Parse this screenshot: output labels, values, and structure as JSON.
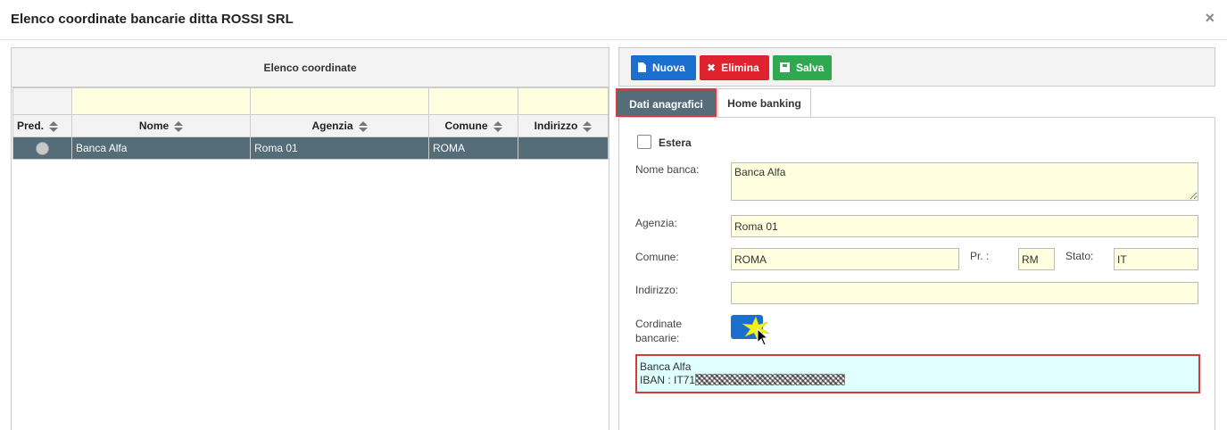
{
  "dialog": {
    "title": "Elenco coordinate bancarie ditta ROSSI SRL",
    "close_label": "×"
  },
  "list_panel": {
    "title": "Elenco coordinate",
    "columns": [
      "Pred.",
      "Nome",
      "Agenzia",
      "Comune",
      "Indirizzo"
    ],
    "rows": [
      {
        "nome": "Banca Alfa",
        "agenzia": "Roma 01",
        "comune": "ROMA",
        "indirizzo": ""
      }
    ]
  },
  "toolbar": {
    "new_label": "Nuova",
    "delete_label": "Elimina",
    "save_label": "Salva"
  },
  "tabs": [
    {
      "label": "Dati anagrafici",
      "active": true
    },
    {
      "label": "Home banking",
      "active": false
    }
  ],
  "form": {
    "estera_label": "Estera",
    "nome_banca_label": "Nome banca:",
    "nome_banca_value": "Banca Alfa",
    "agenzia_label": "Agenzia:",
    "agenzia_value": "Roma 01",
    "comune_label": "Comune:",
    "comune_value": "ROMA",
    "provincia_label": "Pr. :",
    "provincia_value": "RM",
    "stato_label": "Stato:",
    "stato_value": "IT",
    "indirizzo_label": "Indirizzo:",
    "indirizzo_value": "",
    "coordinate_label_line1": "Cordinate",
    "coordinate_label_line2": "bancarie:",
    "bank_info_line1": "Banca Alfa",
    "bank_info_line2": "IBAN : IT71"
  },
  "colors": {
    "selected_row": "#546d78",
    "input_bg": "#ffffe0",
    "highlight_border": "#d63a3a",
    "primary": "#1b6fcf",
    "danger": "#e0212e",
    "success": "#2fa84f"
  }
}
